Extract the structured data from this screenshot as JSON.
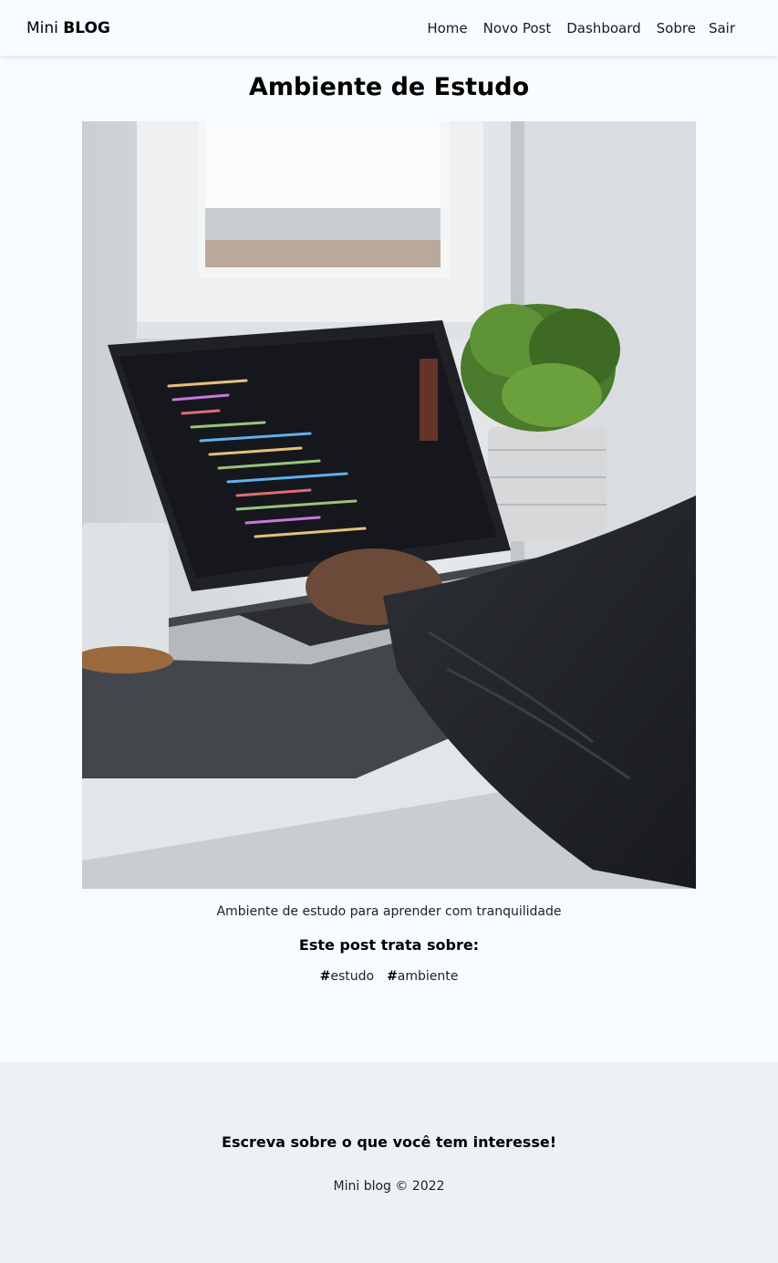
{
  "navbar": {
    "brand_prefix": "Mini",
    "brand_bold": "BLOG",
    "links": [
      {
        "label": "Home"
      },
      {
        "label": "Novo Post"
      },
      {
        "label": "Dashboard"
      },
      {
        "label": "Sobre"
      }
    ],
    "exit_label": "Sair"
  },
  "post": {
    "title": "Ambiente de Estudo",
    "body": "Ambiente de estudo para aprender com tranquilidade",
    "tags_heading": "Este post trata sobre:",
    "tags": [
      {
        "hash": "#",
        "label": "estudo"
      },
      {
        "hash": "#",
        "label": "ambiente"
      }
    ]
  },
  "footer": {
    "title": "Escreva sobre o que você tem interesse!",
    "copyright": "Mini blog © 2022"
  },
  "colors": {
    "page_bg": "#f7fcff",
    "footer_bg": "#edf1f3"
  }
}
